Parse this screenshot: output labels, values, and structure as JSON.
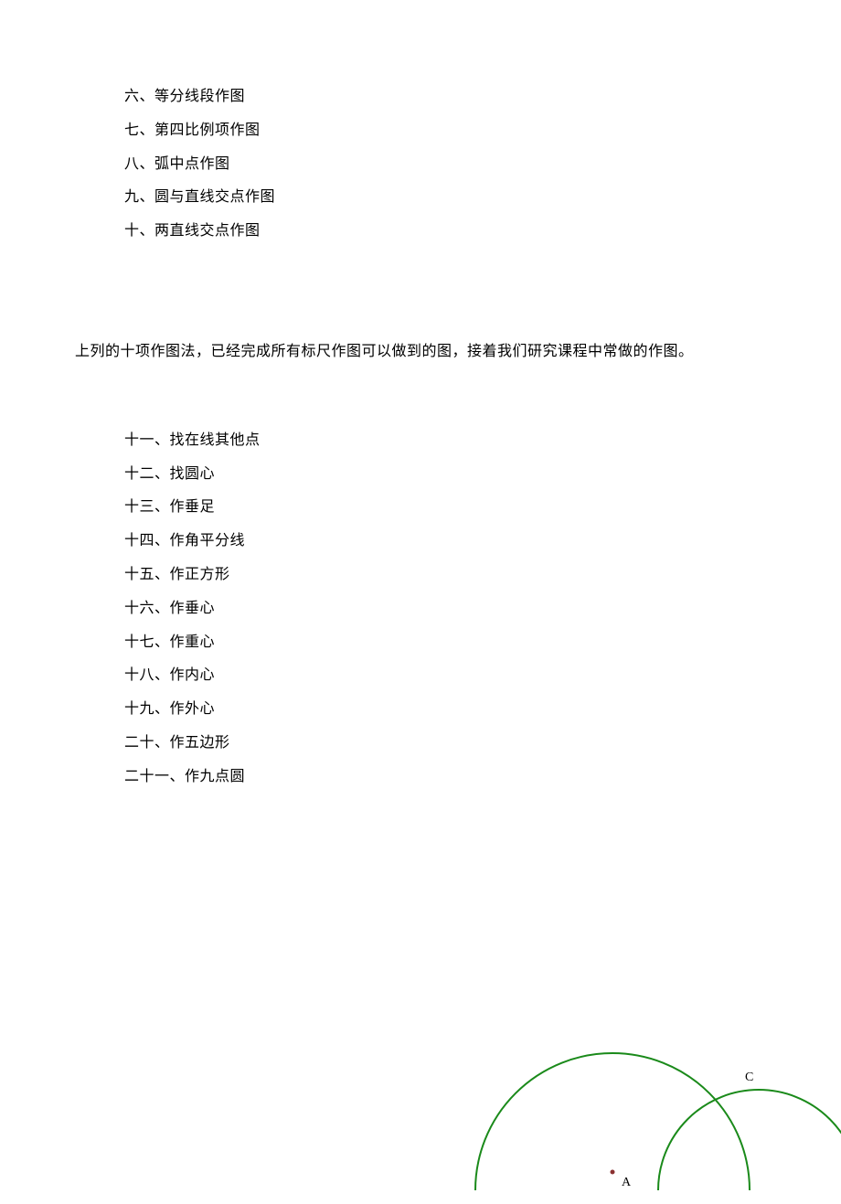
{
  "list1": {
    "items": [
      "六、等分线段作图",
      "七、第四比例项作图",
      "八、弧中点作图",
      "九、圆与直线交点作图",
      "十、两直线交点作图"
    ]
  },
  "paragraph": "上列的十项作图法，已经完成所有标尺作图可以做到的图，接着我们研究课程中常做的作图。",
  "list2": {
    "items": [
      "十一、找在线其他点",
      "十二、找圆心",
      "十三、作垂足",
      "十四、作角平分线",
      "十五、作正方形",
      "十六、作垂心",
      "十七、作重心",
      "十八、作内心",
      "十九、作外心",
      "二十、作五边形",
      "二十一、作九点圆"
    ]
  },
  "diagram": {
    "pointA": "A",
    "pointC": "C"
  }
}
